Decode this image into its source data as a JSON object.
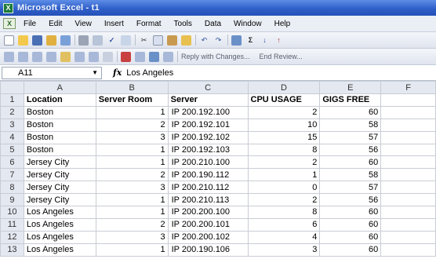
{
  "window": {
    "title": "Microsoft Excel - t1"
  },
  "menubar": {
    "items": [
      "File",
      "Edit",
      "View",
      "Insert",
      "Format",
      "Tools",
      "Data",
      "Window",
      "Help"
    ]
  },
  "toolbar": {
    "reply_label": "Reply with Changes...",
    "end_review_label": "End Review..."
  },
  "formula_bar": {
    "name_box": "A11",
    "fx": "fx",
    "value": "Los Angeles"
  },
  "columns": [
    "",
    "A",
    "B",
    "C",
    "D",
    "E",
    "F"
  ],
  "headers": [
    "Location",
    "Server Room",
    "Server",
    "CPU USAGE",
    "GIGS FREE"
  ],
  "rows": [
    {
      "n": "2",
      "location": "Boston",
      "room": "1",
      "server": "IP 200.192.100",
      "cpu": "2",
      "gigs": "60"
    },
    {
      "n": "3",
      "location": "Boston",
      "room": "2",
      "server": "IP 200.192.101",
      "cpu": "10",
      "gigs": "58"
    },
    {
      "n": "4",
      "location": "Boston",
      "room": "3",
      "server": "IP 200.192.102",
      "cpu": "15",
      "gigs": "57"
    },
    {
      "n": "5",
      "location": "Boston",
      "room": "1",
      "server": "IP 200.192.103",
      "cpu": "8",
      "gigs": "56"
    },
    {
      "n": "6",
      "location": "Jersey City",
      "room": "1",
      "server": "IP 200.210.100",
      "cpu": "2",
      "gigs": "60"
    },
    {
      "n": "7",
      "location": "Jersey City",
      "room": "2",
      "server": "IP 200.190.112",
      "cpu": "1",
      "gigs": "58"
    },
    {
      "n": "8",
      "location": "Jersey City",
      "room": "3",
      "server": "IP 200.210.112",
      "cpu": "0",
      "gigs": "57"
    },
    {
      "n": "9",
      "location": "Jersey City",
      "room": "1",
      "server": "IP 200.210.113",
      "cpu": "2",
      "gigs": "56"
    },
    {
      "n": "10",
      "location": "Los Angeles",
      "room": "1",
      "server": "IP 200.200.100",
      "cpu": "8",
      "gigs": "60"
    },
    {
      "n": "11",
      "location": "Los Angeles",
      "room": "2",
      "server": "IP 200.200.101",
      "cpu": "6",
      "gigs": "60"
    },
    {
      "n": "12",
      "location": "Los Angeles",
      "room": "3",
      "server": "IP 200.200.102",
      "cpu": "4",
      "gigs": "60"
    },
    {
      "n": "13",
      "location": "Los Angeles",
      "room": "1",
      "server": "IP 200.190.106",
      "cpu": "3",
      "gigs": "60"
    }
  ],
  "colors": {
    "titlebar": "#2f5fc9",
    "header_bg": "#e4e8f0",
    "grid_line": "#c8ccd4"
  }
}
